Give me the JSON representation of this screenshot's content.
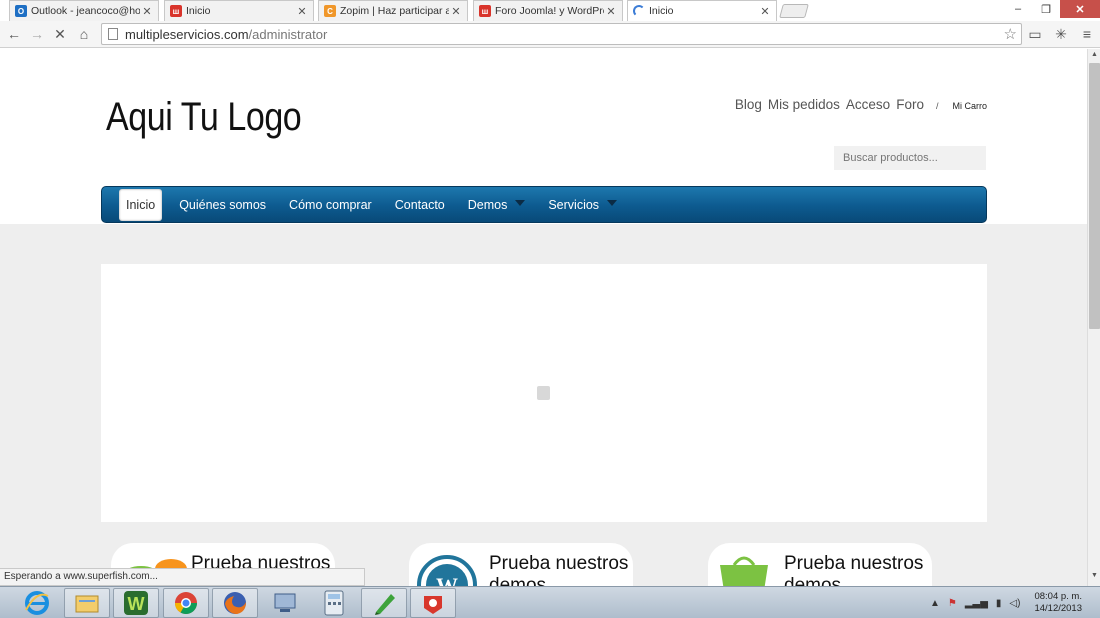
{
  "browser": {
    "tabs": [
      {
        "title": "Outlook - jeancoco@hotm",
        "favicon": "outlook-icon",
        "color": "#1e6fc4",
        "active": false
      },
      {
        "title": "Inicio",
        "favicon": "joomla-icon",
        "color": "#d9342b",
        "active": false
      },
      {
        "title": "Zopim | Haz participar a tu",
        "favicon": "zopim-icon",
        "color": "#f0972a",
        "active": false
      },
      {
        "title": "Foro Joomla! y WordPress",
        "favicon": "joomla-icon",
        "color": "#d9342b",
        "active": false
      },
      {
        "title": "Inicio",
        "favicon": "loading-spinner-icon",
        "color": "#3b7cd6",
        "active": true
      }
    ],
    "url_domain": "multipleservicios.com",
    "url_path": "/administrator"
  },
  "site": {
    "logo_text": "Aqui Tu Logo",
    "top_links": [
      "Blog",
      "Mis pedidos",
      "Acceso",
      "Foro"
    ],
    "separator": "/",
    "cart_label": "Mi Carro",
    "search_placeholder": "Buscar productos...",
    "nav": [
      {
        "label": "Inicio",
        "active": true,
        "dropdown": false
      },
      {
        "label": "Quiénes somos",
        "active": false,
        "dropdown": false
      },
      {
        "label": "Cómo comprar",
        "active": false,
        "dropdown": false
      },
      {
        "label": "Contacto",
        "active": false,
        "dropdown": false
      },
      {
        "label": "Demos",
        "active": false,
        "dropdown": true
      },
      {
        "label": "Servicios",
        "active": false,
        "dropdown": true
      }
    ],
    "promos": [
      {
        "text": "Prueba nuestros",
        "icon": "joomla-logo-icon"
      },
      {
        "text": "Prueba nuestros demos",
        "icon": "wordpress-logo-icon"
      },
      {
        "text": "Prueba nuestros demos",
        "icon": "shopping-bag-icon"
      }
    ]
  },
  "status_text": "Esperando a www.superfish.com...",
  "taskbar": {
    "apps": [
      "internet-explorer-icon",
      "file-explorer-icon",
      "w-app-icon",
      "chrome-icon",
      "firefox-icon",
      "network-app-icon",
      "calculator-icon",
      "green-app-icon",
      "camera-app-icon"
    ],
    "time": "08:04 p. m.",
    "date": "14/12/2013"
  },
  "colors": {
    "nav_blue": "#0d5a8f",
    "page_bg": "#eeeeee"
  }
}
